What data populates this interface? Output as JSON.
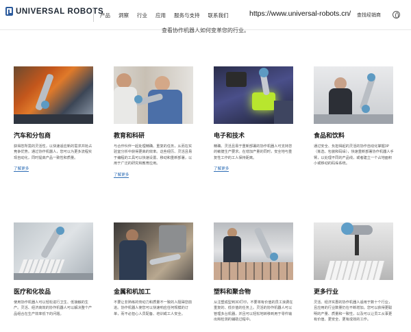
{
  "header": {
    "logo_text": "UNIVERSAL ROBOTS",
    "nav": [
      "产品",
      "洞察",
      "行业",
      "应用",
      "服务与支持",
      "联系我们"
    ],
    "url_text": "https://www.universal-robots.cn/",
    "dealer_label": "查找经销商",
    "lang_icon": "globe-icon"
  },
  "intro_text": "查看协作机器人如何变革您的行业。",
  "industries": [
    {
      "title": "汽车和分包商",
      "desc": "获得您所需的灵活性，以快速适应新的需求并抢占竞争优势。通过协作机器人，您可以为更多流程实现自动化，同时提高产品一致性和质量。",
      "link": "了解更多"
    },
    {
      "title": "教育和科研",
      "desc": "与合作伙伴一起处理精确、重复的任务，从而在实验室分析中获得更高的效率。这些经历、灵活且易于编程的工具可以快速设置、移动和重新部署，以用于广泛的研究和教育应用。",
      "link": "了解更多"
    },
    {
      "title": "电子和技术",
      "desc": "精确、灵活且易于重新部署的协作机器人可支持您的敏捷生产要求。在增加产量的同时，安全地与重复性工作的工人保持距离。",
      "link": "了解更多"
    },
    {
      "title": "食品和饮料",
      "desc": "通过安全、负担得起的灵活的协作自动化掌握3P（拣选、包装和码垛），快速重新部署协作机器人手臂，以处理不同的产品线，或者建立一个占地面积小或移动的码垛系统。",
      "link": ""
    },
    {
      "title": "医疗和化妆品",
      "desc": "使用协作机器人可以轻松进行卫生、低接触的生产。灵活、经济高效的协作机器人可以解决整个产品组合在生产效率低下的问题。",
      "link": ""
    },
    {
      "title": "金属和机加工",
      "desc": "不要让非熟练的劳动力和质量不一致的人阻碍您前进。协作机器人使您可以快速响应任何规模的订单，而不必担心人员配备、培训或工人安全。",
      "link": ""
    },
    {
      "title": "塑料和聚合物",
      "desc": "从注塑成型到3D打印，不要将有价值的员工浪费在重复的、低价值的任务上。灵活的协作机器人可以管理多台机器，并且可以轻松地转移到用于零件输出和检测的辅助过程中。",
      "link": ""
    },
    {
      "title": "更多行业",
      "desc": "灵活、经济实惠的协作机器人适用于数十个行业，且应用的行业数量仍在不断增加。您可以获得更聪明的产量、质量和一致性，以及可以让员工从事更有价值、更安全、更有成效的工作。",
      "link": ""
    }
  ]
}
